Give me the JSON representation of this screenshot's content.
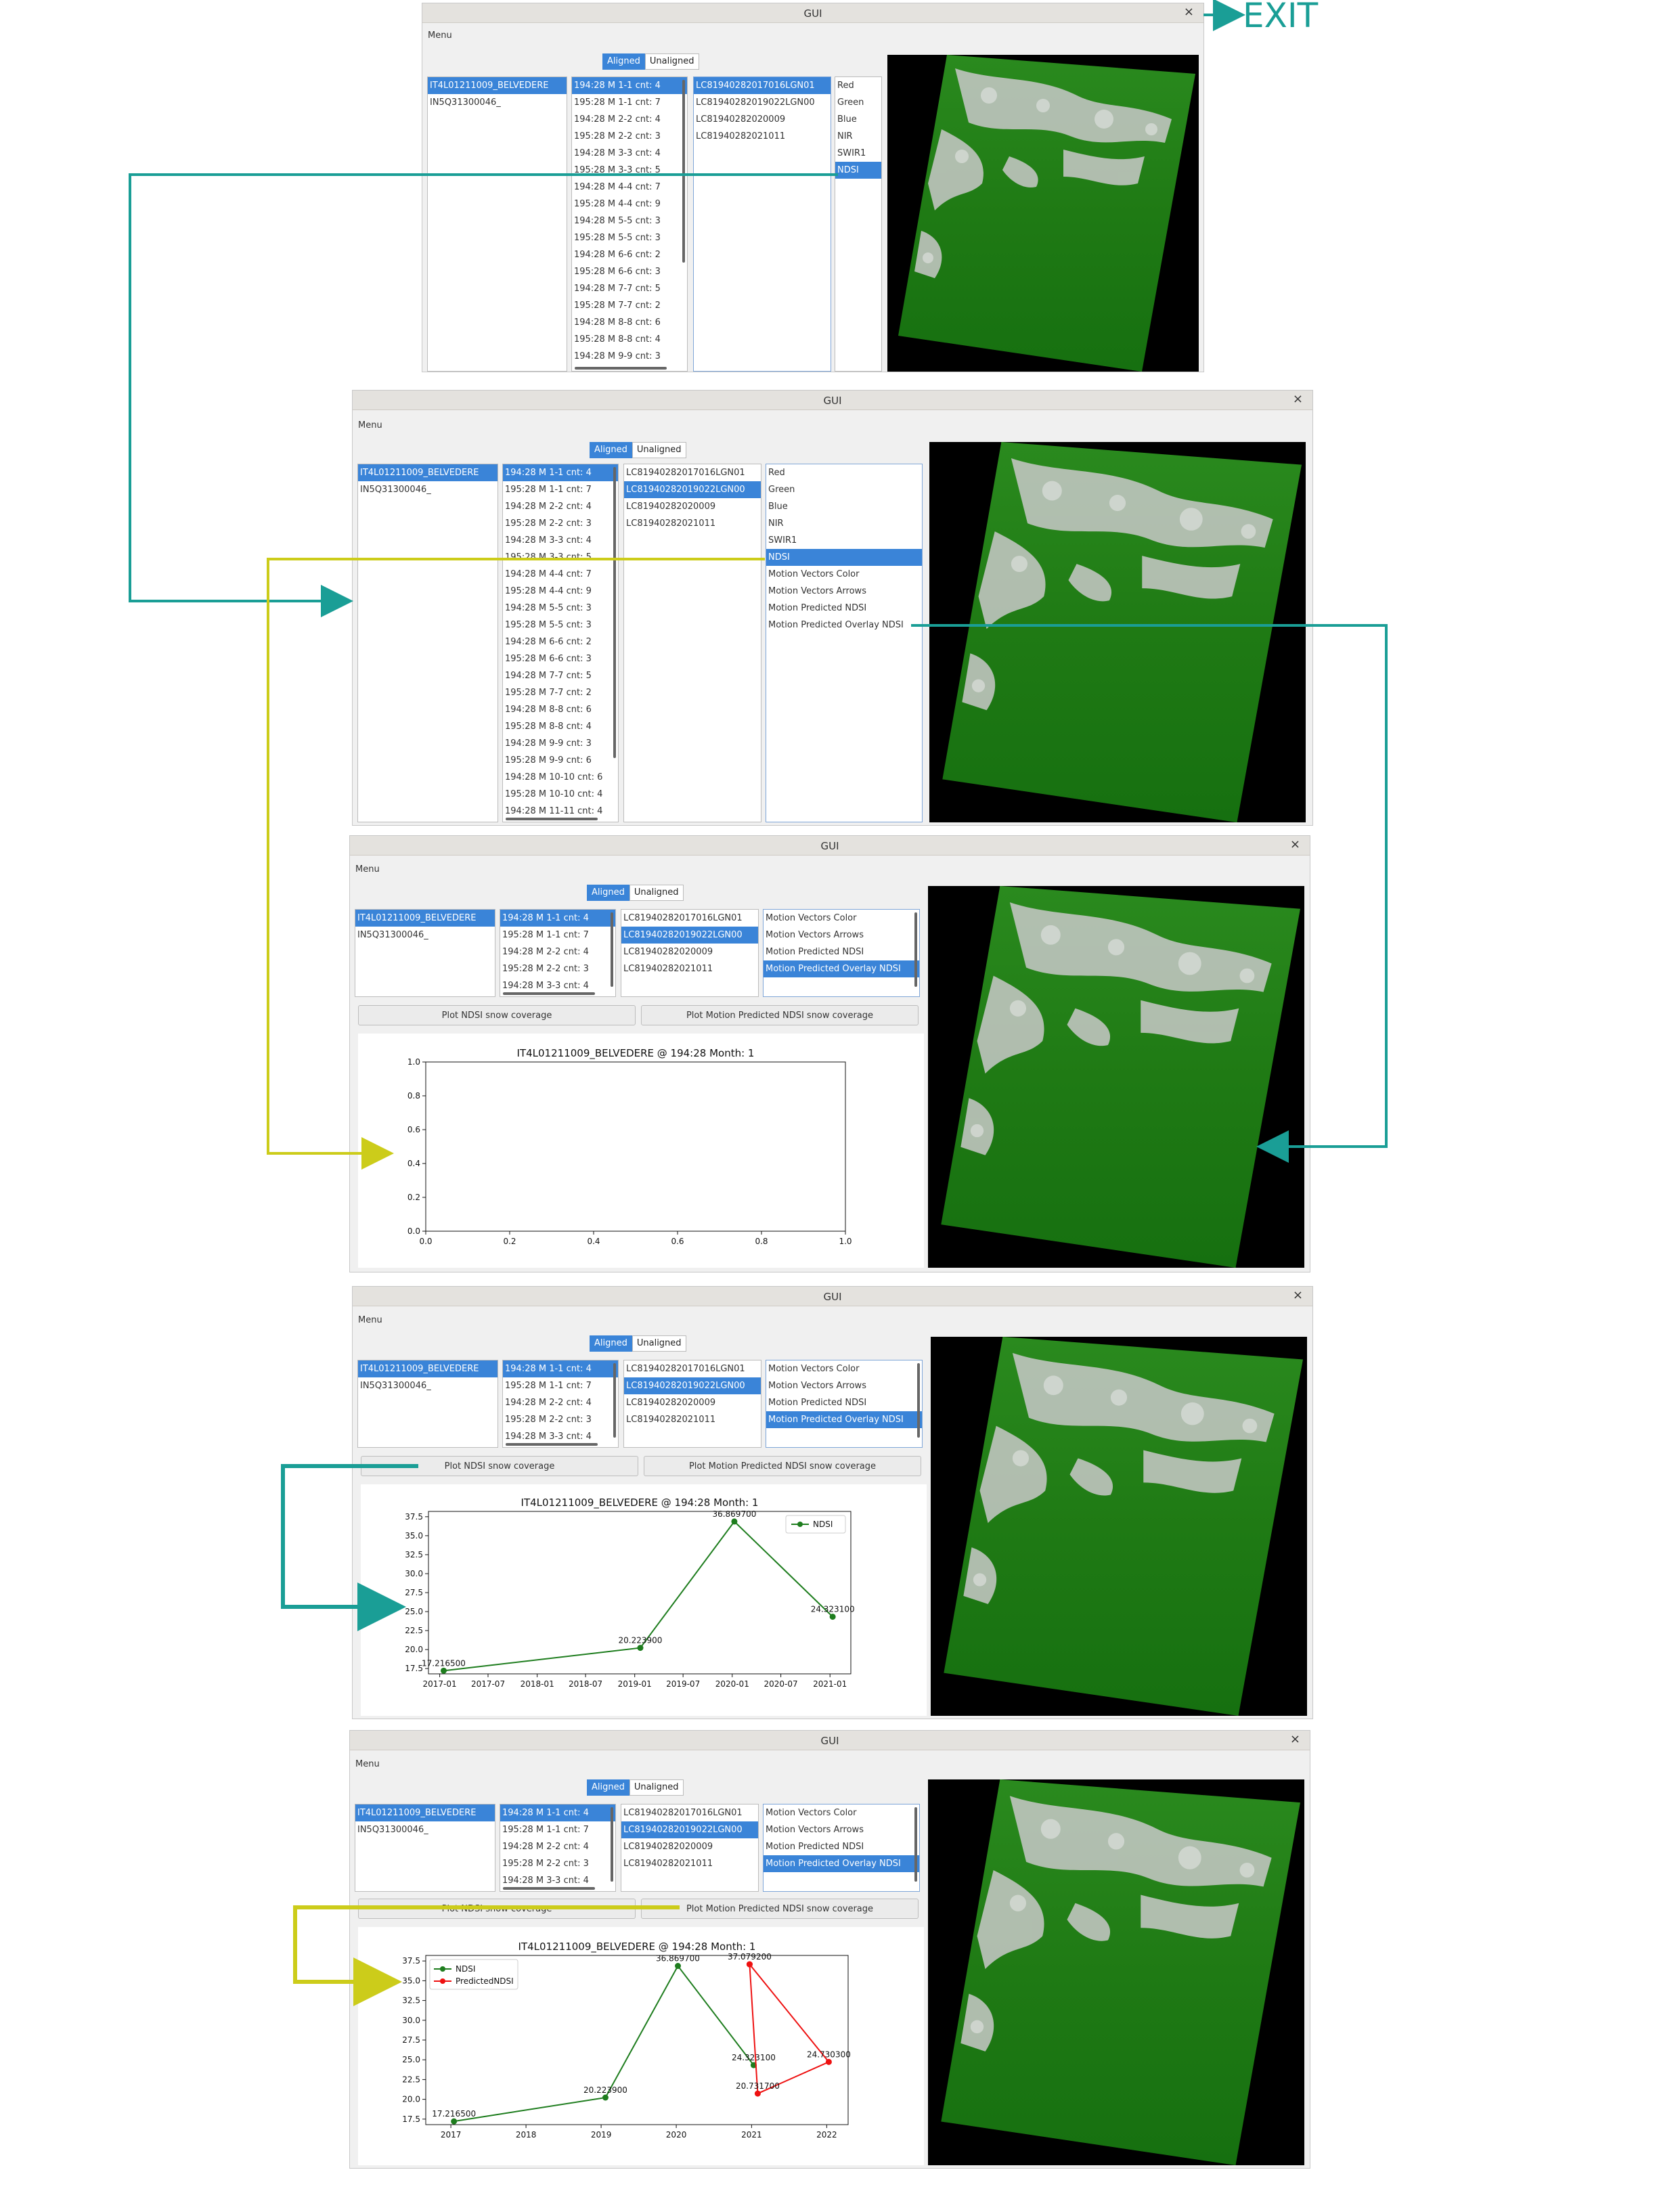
{
  "window_title": "GUI",
  "close_glyph": "×",
  "menu_label": "Menu",
  "tabs": [
    "Aligned",
    "Unaligned"
  ],
  "exit_label": "EXIT",
  "glaciers": [
    "IT4L01211009_BELVEDERE",
    "IN5Q31300046_"
  ],
  "months_long": [
    "194:28 M 1-1 cnt: 4",
    "195:28 M 1-1 cnt: 7",
    "194:28 M 2-2 cnt: 4",
    "195:28 M 2-2 cnt: 3",
    "194:28 M 3-3 cnt: 4",
    "195:28 M 3-3 cnt: 5",
    "194:28 M 4-4 cnt: 7",
    "195:28 M 4-4 cnt: 9",
    "194:28 M 5-5 cnt: 3",
    "195:28 M 5-5 cnt: 3",
    "194:28 M 6-6 cnt: 2",
    "195:28 M 6-6 cnt: 3",
    "194:28 M 7-7 cnt: 5",
    "195:28 M 7-7 cnt: 2",
    "194:28 M 8-8 cnt: 6",
    "195:28 M 8-8 cnt: 4",
    "194:28 M 9-9 cnt: 3"
  ],
  "months_w2": [
    "194:28 M 1-1 cnt: 4",
    "195:28 M 1-1 cnt: 7",
    "194:28 M 2-2 cnt: 4",
    "195:28 M 2-2 cnt: 3",
    "194:28 M 3-3 cnt: 4",
    "195:28 M 3-3 cnt: 5",
    "194:28 M 4-4 cnt: 7",
    "195:28 M 4-4 cnt: 9",
    "194:28 M 5-5 cnt: 3",
    "195:28 M 5-5 cnt: 3",
    "194:28 M 6-6 cnt: 2",
    "195:28 M 6-6 cnt: 3",
    "194:28 M 7-7 cnt: 5",
    "195:28 M 7-7 cnt: 2",
    "194:28 M 8-8 cnt: 6",
    "195:28 M 8-8 cnt: 4",
    "194:28 M 9-9 cnt: 3",
    "195:28 M 9-9 cnt: 6",
    "194:28 M 10-10 cnt: 6",
    "195:28 M 10-10 cnt: 4",
    "194:28 M 11-11 cnt: 4"
  ],
  "months_short": [
    "194:28 M 1-1 cnt: 4",
    "195:28 M 1-1 cnt: 7",
    "194:28 M 2-2 cnt: 4",
    "195:28 M 2-2 cnt: 3",
    "194:28 M 3-3 cnt: 4"
  ],
  "scenes": [
    "LC81940282017016LGN01",
    "LC81940282019022LGN00",
    "LC81940282020009",
    "LC81940282021011"
  ],
  "bands_short": [
    "Red",
    "Green",
    "Blue",
    "NIR",
    "SWIR1",
    "NDSI"
  ],
  "bands_long": [
    "Red",
    "Green",
    "Blue",
    "NIR",
    "SWIR1",
    "NDSI",
    "Motion Vectors Color",
    "Motion Vectors Arrows",
    "Motion Predicted NDSI",
    "Motion Predicted Overlay NDSI"
  ],
  "bands_tail": [
    "Motion Vectors Color",
    "Motion Vectors Arrows",
    "Motion Predicted NDSI",
    "Motion Predicted Overlay NDSI"
  ],
  "buttons": {
    "plot_ndsi": "Plot NDSI snow coverage",
    "plot_motion": "Plot Motion Predicted NDSI snow coverage"
  },
  "colors": {
    "accent": "#3a84d8",
    "teal_arrow": "#1a9e96",
    "yellow_arrow": "#cccc1a",
    "ndsi_line": "#1e7d1e",
    "predicted_line": "#ee1111"
  },
  "chart_data": [
    {
      "type": "line",
      "title": "IT4L01211009_BELVEDERE @ 194:28 Month: 1",
      "xlim": [
        0.0,
        1.0
      ],
      "ylim": [
        0.0,
        1.0
      ],
      "xticks": [
        "0.0",
        "0.2",
        "0.4",
        "0.6",
        "0.8",
        "1.0"
      ],
      "yticks": [
        "0.0",
        "0.2",
        "0.4",
        "0.6",
        "0.8",
        "1.0"
      ],
      "series": []
    },
    {
      "type": "line",
      "title": "IT4L01211009_BELVEDERE @ 194:28 Month: 1",
      "x": [
        "2017-01-16",
        "2019-01-22",
        "2020-01-09",
        "2021-01-11"
      ],
      "xticks": [
        "2017-01",
        "2017-07",
        "2018-01",
        "2018-07",
        "2019-01",
        "2019-07",
        "2020-01",
        "2020-07",
        "2021-01"
      ],
      "yticks": [
        "17.5",
        "20.0",
        "22.5",
        "25.0",
        "27.5",
        "30.0",
        "32.5",
        "35.0",
        "37.5"
      ],
      "legend": "top-right",
      "series": [
        {
          "name": "NDSI",
          "color": "#1e7d1e",
          "values": [
            17.2165,
            20.2239,
            36.8697,
            24.3231
          ],
          "labels": [
            "17.216500",
            "20.223900",
            "36.869700",
            "24.323100"
          ]
        }
      ]
    },
    {
      "type": "line",
      "title": "IT4L01211009_BELVEDERE @ 194:28 Month: 1",
      "xticks": [
        "2017",
        "2018",
        "2019",
        "2020",
        "2021",
        "2022"
      ],
      "yticks": [
        "17.5",
        "20.0",
        "22.5",
        "25.0",
        "27.5",
        "30.0",
        "32.5",
        "35.0",
        "37.5"
      ],
      "legend": "top-left",
      "series": [
        {
          "name": "NDSI",
          "color": "#1e7d1e",
          "x": [
            "2017-01-16",
            "2019-01-22",
            "2020-01-09",
            "2021-01-11"
          ],
          "values": [
            17.2165,
            20.2239,
            36.8697,
            24.3231
          ],
          "labels": [
            "17.216500",
            "20.223900",
            "36.869700",
            "24.323100"
          ]
        },
        {
          "name": "PredictedNDSI",
          "color": "#ee1111",
          "x": [
            "2021-01-11",
            "2021-01-11",
            "2022-01-11",
            "2021-01-11"
          ],
          "values": [
            37.0792,
            20.7317,
            24.7303,
            37.0792
          ],
          "labels": [
            "37.079200",
            "20.731700",
            "24.730300",
            ""
          ]
        }
      ]
    }
  ]
}
